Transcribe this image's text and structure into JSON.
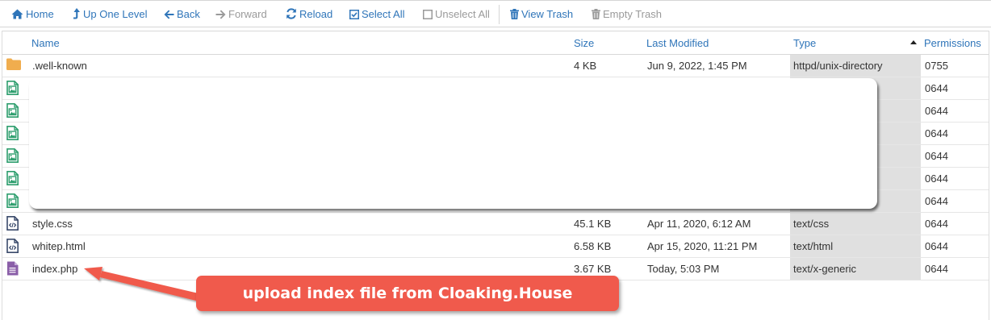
{
  "toolbar": {
    "home": "Home",
    "up_one_level": "Up One Level",
    "back": "Back",
    "forward": "Forward",
    "reload": "Reload",
    "select_all": "Select All",
    "unselect_all": "Unselect All",
    "view_trash": "View Trash",
    "empty_trash": "Empty Trash"
  },
  "columns": {
    "name": "Name",
    "size": "Size",
    "last_modified": "Last Modified",
    "type": "Type",
    "permissions": "Permissions"
  },
  "rows": [
    {
      "icon": "folder-icon",
      "name": ".well-known",
      "size": "4 KB",
      "modified": "Jun 9, 2022, 1:45 PM",
      "type": "httpd/unix-directory",
      "perms": "0755"
    },
    {
      "icon": "image-file-icon",
      "name": "",
      "size": "",
      "modified": "",
      "type": "",
      "perms": "0644"
    },
    {
      "icon": "image-file-icon",
      "name": "",
      "size": "",
      "modified": "",
      "type": "",
      "perms": "0644"
    },
    {
      "icon": "image-file-icon",
      "name": "",
      "size": "",
      "modified": "",
      "type": "",
      "perms": "0644"
    },
    {
      "icon": "image-file-icon",
      "name": "",
      "size": "",
      "modified": "",
      "type": "",
      "perms": "0644"
    },
    {
      "icon": "image-file-icon",
      "name": "",
      "size": "",
      "modified": "",
      "type": "",
      "perms": "0644"
    },
    {
      "icon": "image-file-icon",
      "name": "",
      "size": "",
      "modified": "",
      "type": "",
      "perms": "0644"
    },
    {
      "icon": "code-file-icon",
      "name": "style.css",
      "size": "45.1 KB",
      "modified": "Apr 11, 2020, 6:12 AM",
      "type": "text/css",
      "perms": "0644"
    },
    {
      "icon": "code-file-icon",
      "name": "whitep.html",
      "size": "6.58 KB",
      "modified": "Apr 15, 2020, 11:21 PM",
      "type": "text/html",
      "perms": "0644"
    },
    {
      "icon": "text-file-icon",
      "name": "index.php",
      "size": "3.67 KB",
      "modified": "Today, 5:03 PM",
      "type": "text/x-generic",
      "perms": "0644"
    }
  ],
  "annotation": {
    "text": "upload index file from Cloaking.House"
  },
  "colors": {
    "link": "#2f75b9",
    "folder": "#f0ad4e",
    "image_icon": "#2e9e6e",
    "php_icon": "#8a5ea8",
    "callout": "#f05a4c"
  }
}
